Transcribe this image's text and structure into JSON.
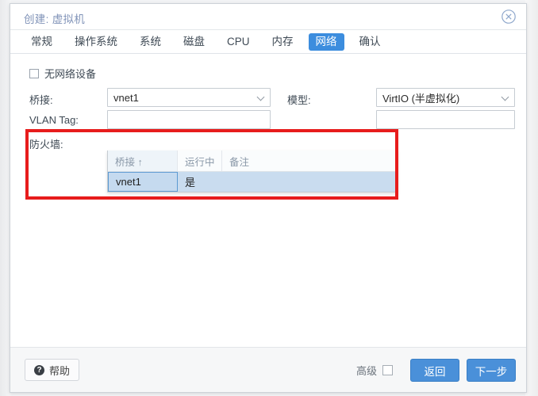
{
  "window": {
    "title": "创建: 虚拟机",
    "close_icon": "close-circle-icon"
  },
  "tabs": [
    {
      "label": "常规",
      "active": false
    },
    {
      "label": "操作系统",
      "active": false
    },
    {
      "label": "系统",
      "active": false
    },
    {
      "label": "磁盘",
      "active": false
    },
    {
      "label": "CPU",
      "active": false
    },
    {
      "label": "内存",
      "active": false
    },
    {
      "label": "网络",
      "active": true
    },
    {
      "label": "确认",
      "active": false
    }
  ],
  "form": {
    "no_network_device": {
      "label": "无网络设备",
      "checked": false
    },
    "rows": [
      {
        "label": "桥接:",
        "value": "vnet1",
        "mid_label": "模型:",
        "mid_value": "VirtIO (半虚拟化)"
      },
      {
        "label": "VLAN Tag:",
        "value": "",
        "mid_label": "",
        "mid_value": ""
      },
      {
        "label": "防火墙:",
        "value": "",
        "mid_label": "",
        "mid_value": ""
      }
    ]
  },
  "dropdown": {
    "open": true,
    "columns": [
      "桥接 ↑",
      "运行中",
      "备注"
    ],
    "rows": [
      {
        "bridge": "vnet1",
        "running": "是",
        "comment": ""
      }
    ]
  },
  "highlight": {
    "color": "#e71c1c"
  },
  "footer": {
    "help_label": "帮助",
    "help_icon": "question-circle-icon",
    "advanced_label": "高级",
    "advanced_checked": false,
    "back_label": "返回",
    "next_label": "下一步"
  },
  "colors": {
    "accent": "#4a90d9",
    "tab_active": "#3c8dde",
    "highlight_red": "#e71c1c",
    "row_selected": "#c9dcef"
  }
}
